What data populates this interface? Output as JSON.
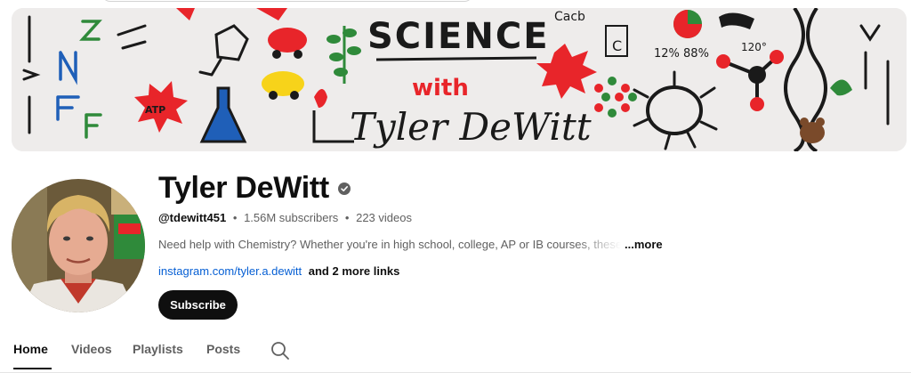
{
  "banner": {
    "title_line1": "SCIENCE",
    "title_line2": "with",
    "title_line3": "Tyler DeWitt"
  },
  "channel": {
    "name": "Tyler DeWitt",
    "handle": "@tdewitt451",
    "subscribers": "1.56M subscribers",
    "videos": "223 videos",
    "separator": "•",
    "description": "Need help with Chemistry? Whether you're in high school, college, AP or IB courses, these",
    "more_label": "...more",
    "link_text": "instagram.com/tyler.a.dewitt",
    "more_links": "and 2 more links",
    "subscribe_label": "Subscribe"
  },
  "tabs": [
    {
      "label": "Home",
      "active": true
    },
    {
      "label": "Videos",
      "active": false
    },
    {
      "label": "Playlists",
      "active": false
    },
    {
      "label": "Posts",
      "active": false
    }
  ],
  "icons": {
    "verified": "verified-check-icon",
    "search": "search-icon"
  },
  "colors": {
    "text_primary": "#0f0f0f",
    "text_secondary": "#606060",
    "link": "#065fd4",
    "subscribe_bg": "#0f0f0f"
  }
}
